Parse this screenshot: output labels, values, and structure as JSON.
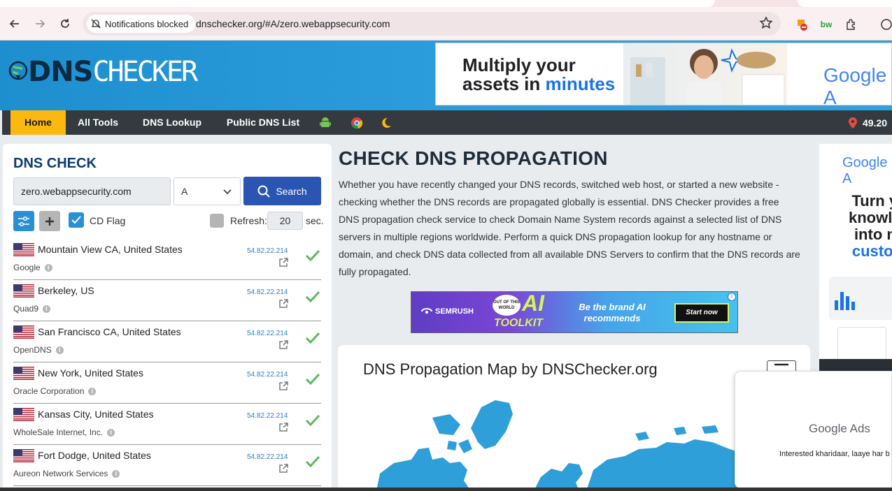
{
  "browser": {
    "notification_chip": "Notifications blocked",
    "url": "dnschecker.org/#A/zero.webappsecurity.com"
  },
  "header": {
    "logo_dns": "DNS",
    "logo_checker": "CHECKER",
    "ad": {
      "headline_line1": "Multiply your",
      "headline_line2_a": "assets in ",
      "headline_line2_b": "minutes",
      "brand": "Google A"
    }
  },
  "nav": {
    "items": [
      {
        "label": "Home"
      },
      {
        "label": "All Tools"
      },
      {
        "label": "DNS Lookup"
      },
      {
        "label": "Public DNS List"
      }
    ],
    "ip_partial": "49.20"
  },
  "dns_check": {
    "title": "DNS CHECK",
    "host_value": "zero.webappsecurity.com",
    "record_type": "A",
    "search_label": "Search",
    "cd_flag_label": "CD Flag",
    "refresh_label": "Refresh:",
    "refresh_value": "20",
    "refresh_unit": "sec.",
    "servers": [
      {
        "location": "Mountain View CA, United States",
        "provider": "Google",
        "ip": "54.82.22.214"
      },
      {
        "location": "Berkeley, US",
        "provider": "Quad9",
        "ip": "54.82.22.214"
      },
      {
        "location": "San Francisco CA, United States",
        "provider": "OpenDNS",
        "ip": "54.82.22.214"
      },
      {
        "location": "New York, United States",
        "provider": "Oracle Corporation",
        "ip": "54.82.22.214"
      },
      {
        "location": "Kansas City, United States",
        "provider": "WholeSale Internet, Inc.",
        "ip": "54.82.22.214"
      },
      {
        "location": "Fort Dodge, United States",
        "provider": "Aureon Network Services",
        "ip": "54.82.22.214"
      }
    ]
  },
  "main": {
    "title": "CHECK DNS PROPAGATION",
    "description": "Whether you have recently changed your DNS records, switched web host, or started a new website - checking whether the DNS records are propagated globally is essential. DNS Checker provides a free DNS propagation check service to check Domain Name System records against a selected list of DNS servers in multiple regions worldwide. Perform a quick DNS propagation lookup for any hostname or domain, and check DNS data collected from all available DNS Servers to confirm that the DNS records are fully propagated.",
    "semrush_ad": {
      "brand": "SEMRUSH",
      "badge_line1": "OUT OF THIS",
      "badge_line2": "WORLD",
      "ai_word": "AI",
      "toolkit_word": "TOOLKIT",
      "tagline": "Be the brand AI recommends",
      "cta": "Start now"
    },
    "map_title": "DNS Propagation Map by DNSChecker.org"
  },
  "side_ad": {
    "brand": "Google A",
    "line1": "Turn yo",
    "line2": "knowled",
    "line3": "into ne",
    "line4": "custom"
  },
  "floating_ad": {
    "brand": "Google Ads",
    "sub": "Interested kharidaar, laaye har b"
  },
  "colors": {
    "header_blue": "#2c9ddc",
    "nav_dark": "#343a40",
    "nav_active": "#fbb80f",
    "search_blue": "#2a55b3",
    "check_green": "#5cb85c"
  }
}
